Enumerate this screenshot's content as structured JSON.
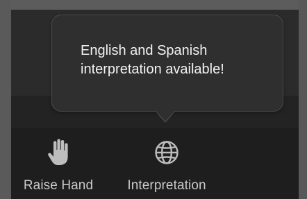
{
  "tooltip": {
    "text": "English and Spanish interpretation available!"
  },
  "toolbar": {
    "raise_hand": {
      "label": "Raise Hand",
      "icon": "hand-icon"
    },
    "interpretation": {
      "label": "Interpretation",
      "icon": "globe-icon"
    }
  },
  "colors": {
    "toolbar_bg": "#1e1e1e",
    "tooltip_bg": "#2f2f2f",
    "label_text": "#c9c9c9",
    "tooltip_text": "#f2f2f2"
  }
}
